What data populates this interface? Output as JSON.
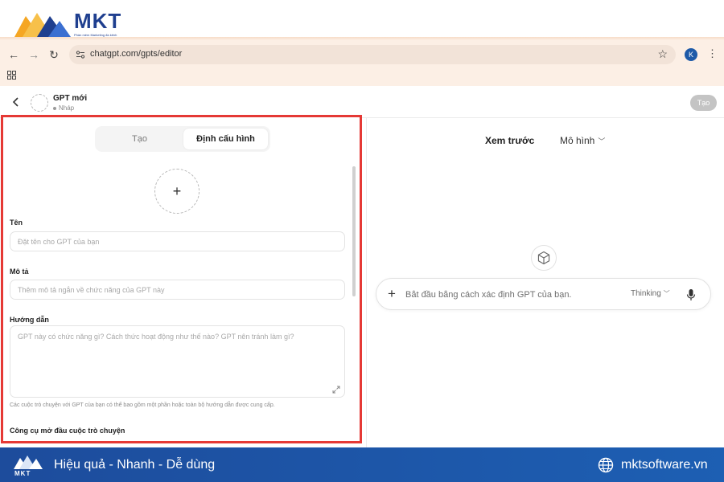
{
  "brand": {
    "name": "MKT",
    "tagline": "Phần mềm Marketing đa kênh",
    "colors": {
      "primary": "#1f3f8f",
      "accent": "#f5a623"
    }
  },
  "browser": {
    "url": "chatgpt.com/gpts/editor",
    "profile_initial": "K",
    "icons": [
      "back-arrow-icon",
      "forward-arrow-icon",
      "reload-icon",
      "site-settings-icon",
      "bookmark-star-icon",
      "more-vert-icon",
      "apps-grid-icon"
    ]
  },
  "header": {
    "gpt_name": "GPT mới",
    "status": "Nháp",
    "create_button": "Tạo"
  },
  "editor": {
    "tabs": [
      {
        "label": "Tạo",
        "active": false
      },
      {
        "label": "Định cấu hình",
        "active": true
      }
    ],
    "upload_symbol": "+",
    "name_label": "Tên",
    "name_placeholder": "Đặt tên cho GPT của bạn",
    "description_label": "Mô tả",
    "description_placeholder": "Thêm mô tả ngắn về chức năng của GPT này",
    "instructions_label": "Hướng dẫn",
    "instructions_placeholder": "GPT này có chức năng gì? Cách thức hoạt động như thế nào? GPT nên tránh làm gì?",
    "instructions_hint": "Các cuộc trò chuyện với GPT của bạn có thể bao gồm một phần hoặc toàn bộ hướng dẫn được cung cấp.",
    "conversation_starters_label": "Công cụ mở đầu cuộc trò chuyện"
  },
  "preview": {
    "title": "Xem trước",
    "model_label": "Mô hình",
    "chat_placeholder": "Bắt đầu bằng cách xác định GPT của bạn.",
    "plus_symbol": "+",
    "mode_label": "Thinking"
  },
  "footer": {
    "logo_text": "MKT",
    "slogan": "Hiệu quả - Nhanh - Dễ dùng",
    "website": "mktsoftware.vn"
  }
}
